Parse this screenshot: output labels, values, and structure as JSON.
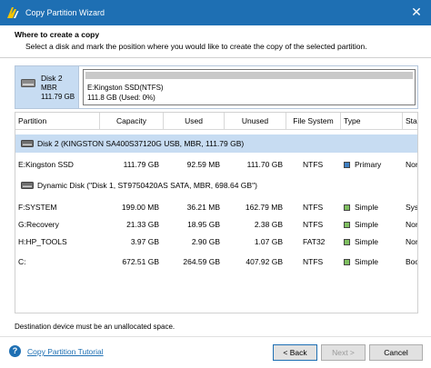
{
  "window": {
    "title": "Copy Partition Wizard",
    "close_glyph": "✕"
  },
  "header": {
    "title": "Where to create a copy",
    "subtitle": "Select a disk and mark the position where you would like to create the copy of the selected partition."
  },
  "target": {
    "disk_name": "Disk 2",
    "disk_type": "MBR",
    "disk_size": "111.79 GB",
    "partition_label": "E:Kingston SSD(NTFS)",
    "partition_size": "111.8 GB (Used: 0%)"
  },
  "columns": [
    "Partition",
    "Capacity",
    "Used",
    "Unused",
    "File System",
    "Type",
    "Sta"
  ],
  "disks": [
    {
      "label": "Disk 2 (KINGSTON SA400S37120G USB, MBR, 111.79 GB)",
      "selected": true,
      "partitions": [
        {
          "name": "E:Kingston SSD",
          "capacity": "111.79 GB",
          "used": "92.59 MB",
          "unused": "111.70 GB",
          "fs": "NTFS",
          "type": "Primary",
          "type_color": "#3e7fc2",
          "status": "Nor"
        }
      ]
    },
    {
      "label": "Dynamic Disk (\"Disk 1, ST9750420AS SATA, MBR, 698.64 GB\")",
      "selected": false,
      "partitions": [
        {
          "name": "F:SYSTEM",
          "capacity": "199.00 MB",
          "used": "36.21 MB",
          "unused": "162.79 MB",
          "fs": "NTFS",
          "type": "Simple",
          "type_color": "#7fbf60",
          "status": "Syst"
        },
        {
          "name": "G:Recovery",
          "capacity": "21.33 GB",
          "used": "18.95 GB",
          "unused": "2.38 GB",
          "fs": "NTFS",
          "type": "Simple",
          "type_color": "#7fbf60",
          "status": "Non"
        },
        {
          "name": "H:HP_TOOLS",
          "capacity": "3.97 GB",
          "used": "2.90 GB",
          "unused": "1.07 GB",
          "fs": "FAT32",
          "type": "Simple",
          "type_color": "#7fbf60",
          "status": "Non"
        },
        {
          "name": "C:",
          "capacity": "672.51 GB",
          "used": "264.59 GB",
          "unused": "407.92 GB",
          "fs": "NTFS",
          "type": "Simple",
          "type_color": "#7fbf60",
          "status": "Boo"
        }
      ]
    }
  ],
  "note": "Destination device must be an unallocated space.",
  "footer": {
    "help_glyph": "?",
    "tutorial_link": "Copy Partition Tutorial",
    "back_button": "< Back",
    "next_button": "Next >",
    "cancel_button": "Cancel"
  }
}
